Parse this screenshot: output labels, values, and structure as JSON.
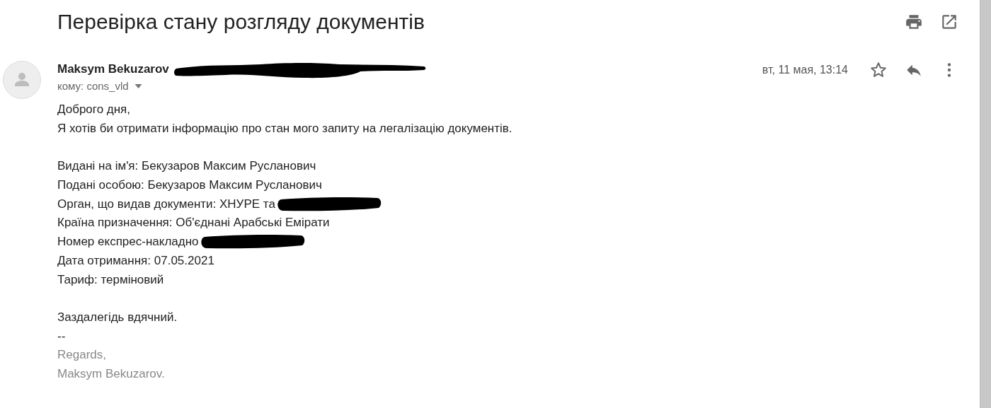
{
  "subject": "Перевірка стану розгляду документів",
  "sender": {
    "name": "Maksym Bekuzarov",
    "redacted": true
  },
  "recipient": {
    "label": "кому: cons_vld"
  },
  "date": "вт, 11 мая, 13:14",
  "starred": false,
  "body": [
    {
      "kind": "text",
      "text": "Доброго дня,"
    },
    {
      "kind": "text",
      "text": "Я хотів би отримати інформацію про стан мого запиту на легалізацію документів."
    },
    {
      "kind": "gap"
    },
    {
      "kind": "text",
      "text": "Видані на ім'я: Бекузаров Максим Русланович"
    },
    {
      "kind": "text",
      "text": "Подані особою: Бекузаров Максим Русланович"
    },
    {
      "kind": "text",
      "text": "Орган, що видав документи: ХНУРЕ та",
      "redacted": true
    },
    {
      "kind": "text",
      "text": "Країна призначення: Об'єднані Арабські Емірати"
    },
    {
      "kind": "text",
      "text": "Номер експрес-накладно",
      "redacted": true
    },
    {
      "kind": "text",
      "text": "Дата отримання: 07.05.2021"
    },
    {
      "kind": "text",
      "text": "Тариф: терміновий"
    },
    {
      "kind": "gap"
    },
    {
      "kind": "text",
      "text": "Заздалегідь вдячний."
    },
    {
      "kind": "text",
      "text": "--"
    },
    {
      "kind": "signature",
      "text": "Regards,"
    },
    {
      "kind": "signature",
      "text": "Maksym Bekuzarov."
    }
  ]
}
